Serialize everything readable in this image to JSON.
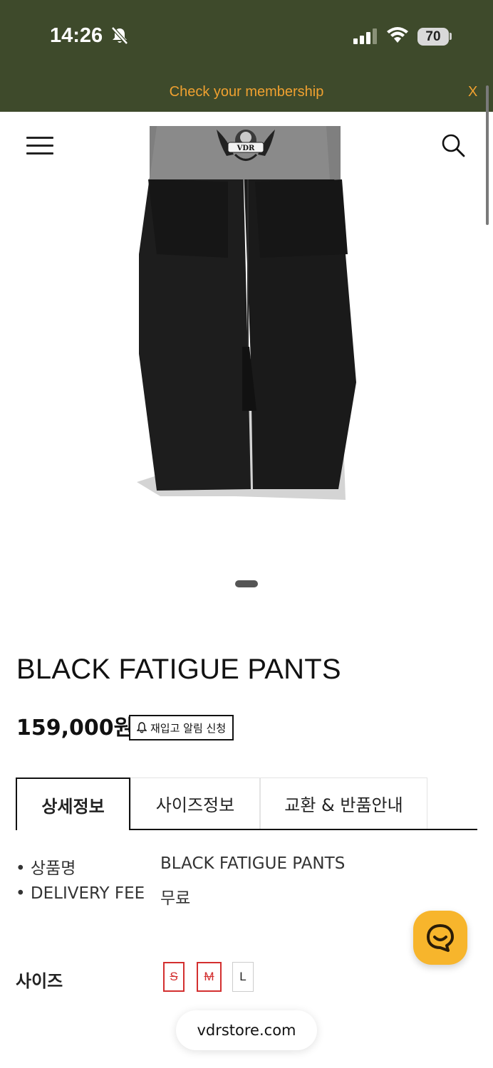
{
  "status_bar": {
    "time": "14:26",
    "battery": "70",
    "icons": [
      "bell-slash-icon",
      "signal-icon",
      "wifi-icon",
      "battery-icon"
    ]
  },
  "membership_banner": {
    "text": "Check your membership",
    "close_label": "X",
    "text_color": "#f0a130",
    "background": "#3e4a2b"
  },
  "header": {
    "menu_icon": "hamburger-menu-icon",
    "search_icon": "search-icon"
  },
  "product_image": {
    "logo_text": "VDR"
  },
  "product": {
    "name": "BLACK FATIGUE PANTS",
    "price": "159,000원",
    "restock_label": "재입고 알림 신청"
  },
  "tabs": [
    {
      "label": "상세정보",
      "active": true
    },
    {
      "label": "사이즈정보",
      "active": false
    },
    {
      "label": "교환 & 반품안내",
      "active": false
    }
  ],
  "details": [
    {
      "bullet": "•",
      "label": "상품명",
      "value": "BLACK FATIGUE PANTS"
    },
    {
      "bullet": "•",
      "label": "DELIVERY FEE",
      "value": "무료"
    }
  ],
  "sizes": {
    "label": "사이즈",
    "options": [
      {
        "label": "S",
        "sold_out": true
      },
      {
        "label": "M",
        "sold_out": true
      },
      {
        "label": "L",
        "sold_out": false
      }
    ],
    "sold_out_color": "#d32f2f"
  },
  "chat_button": {
    "icon": "chat-bubble-icon",
    "color": "#f7b52c"
  },
  "browser": {
    "url": "vdrstore.com"
  }
}
